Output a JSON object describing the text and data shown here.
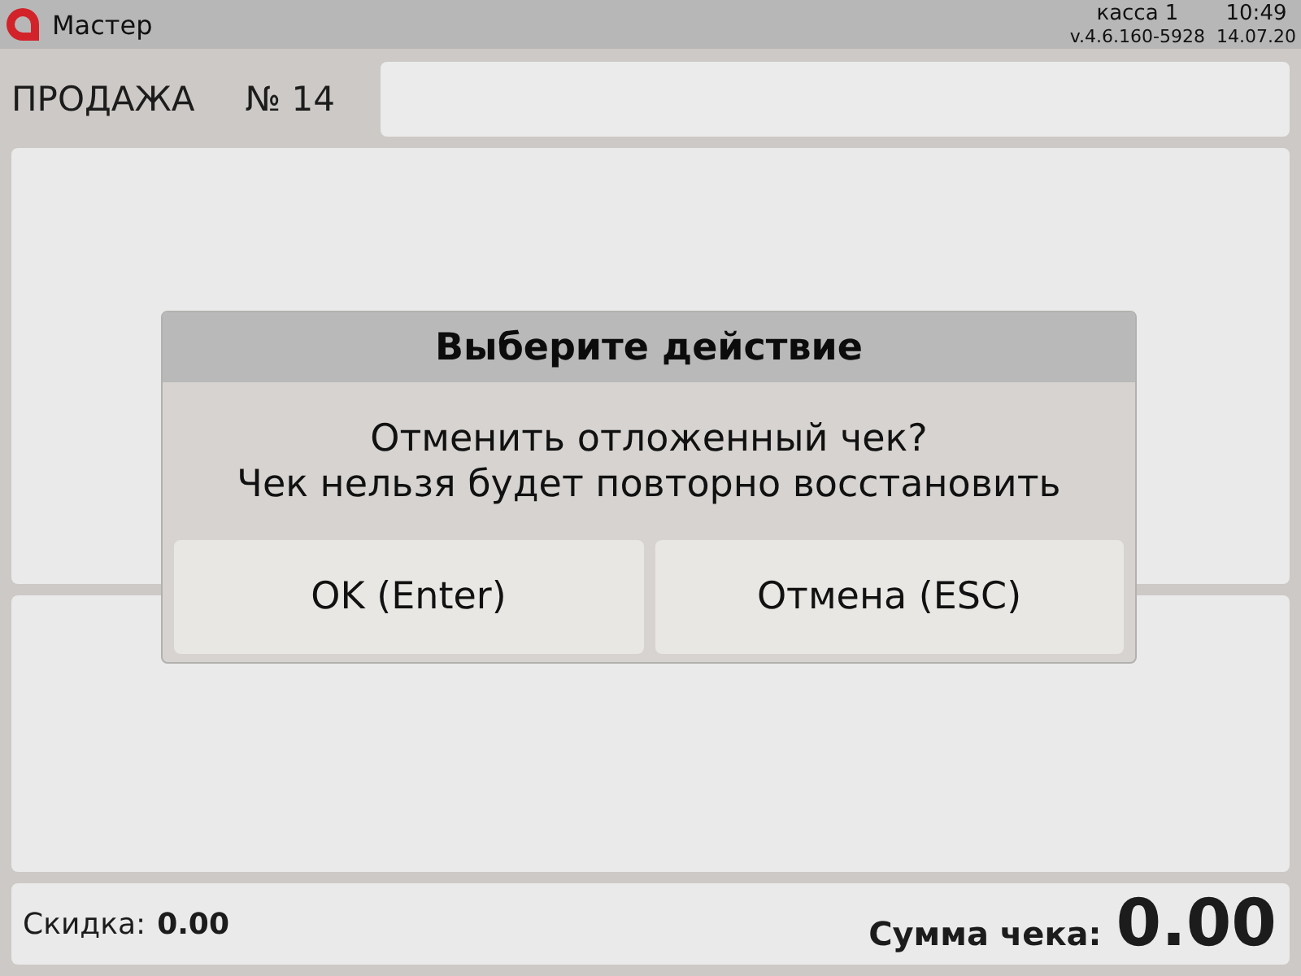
{
  "header": {
    "app_name": "Мастер",
    "register": "касса 1",
    "time": "10:49",
    "version": "v.4.6.160-5928",
    "date": "14.07.20"
  },
  "sale": {
    "title": "ПРОДАЖА",
    "number": "№ 14"
  },
  "dialog": {
    "title": "Выберите действие",
    "message": [
      "Отменить отложенный чек?",
      "Чек нельзя будет повторно восстановить"
    ],
    "buttons": [
      "OK (Enter)",
      "Отмена (ESC)"
    ]
  },
  "footer": {
    "discount_label": "Скидка:",
    "discount_value": "0.00",
    "total_label": "Сумма чека:",
    "total_value": "0.00"
  }
}
